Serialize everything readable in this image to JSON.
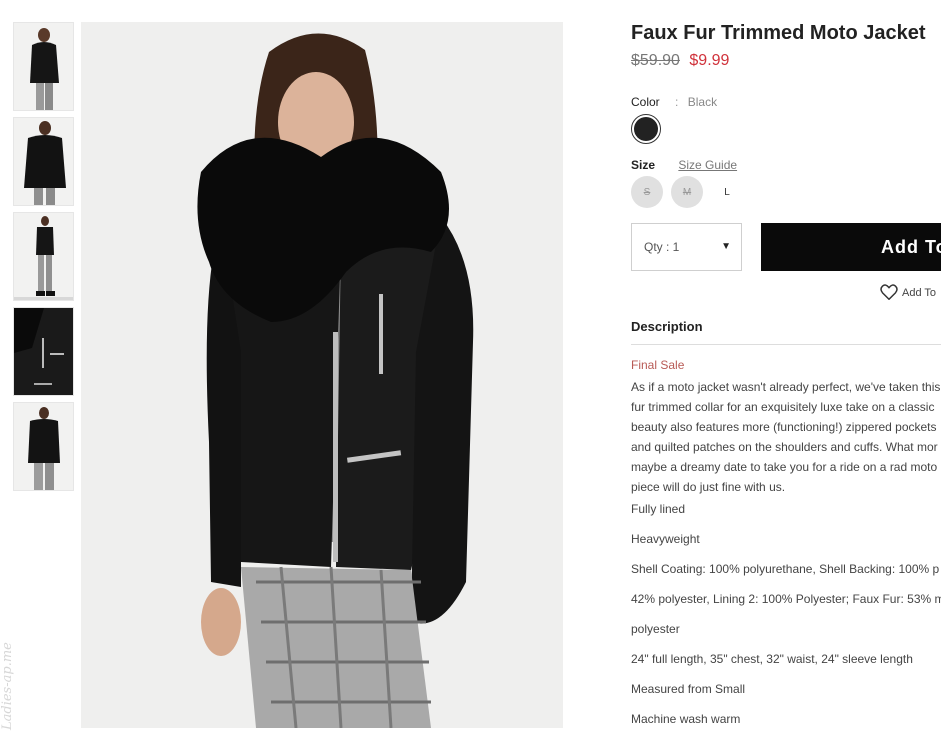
{
  "product": {
    "title": "Faux Fur Trimmed Moto Jacket",
    "price_old": "$59.90",
    "price_new": "$9.99",
    "color_label": "Color",
    "color_sep": ":",
    "color_value": "Black",
    "swatch_color": "#222222",
    "size_label": "Size",
    "size_guide": "Size Guide",
    "sizes": [
      {
        "label": "S",
        "available": false
      },
      {
        "label": "M",
        "available": false
      },
      {
        "label": "L",
        "available": true
      }
    ],
    "qty_label": "Qty : 1",
    "add_button": "Add To",
    "wishlist": "Add To"
  },
  "description": {
    "heading": "Description",
    "final_sale": "Final Sale",
    "paragraph_lines": [
      "As if a moto jacket wasn't already perfect, we've taken this",
      "fur trimmed collar for an exquisitely luxe take on a classic",
      "beauty also features more (functioning!) zippered pockets",
      "and quilted patches on the shoulders and cuffs. What mor",
      "maybe a dreamy date to take you for a ride on a rad moto",
      "piece will do just fine with us."
    ],
    "bullets": [
      "Fully lined",
      "Heavyweight",
      "Shell Coating: 100% polyurethane, Shell Backing: 100% p",
      "42% polyester, Lining 2: 100% Polyester; Faux Fur: 53% m",
      "polyester",
      "24\" full length, 35\" chest, 32\" waist, 24\" sleeve length",
      "Measured from Small",
      "Machine wash warm"
    ]
  },
  "watermark": "Ladies-ap.me",
  "colors": {
    "sale_price": "#d0313a",
    "final_sale": "#b85a55",
    "add_button_bg": "#0a0a0a"
  }
}
